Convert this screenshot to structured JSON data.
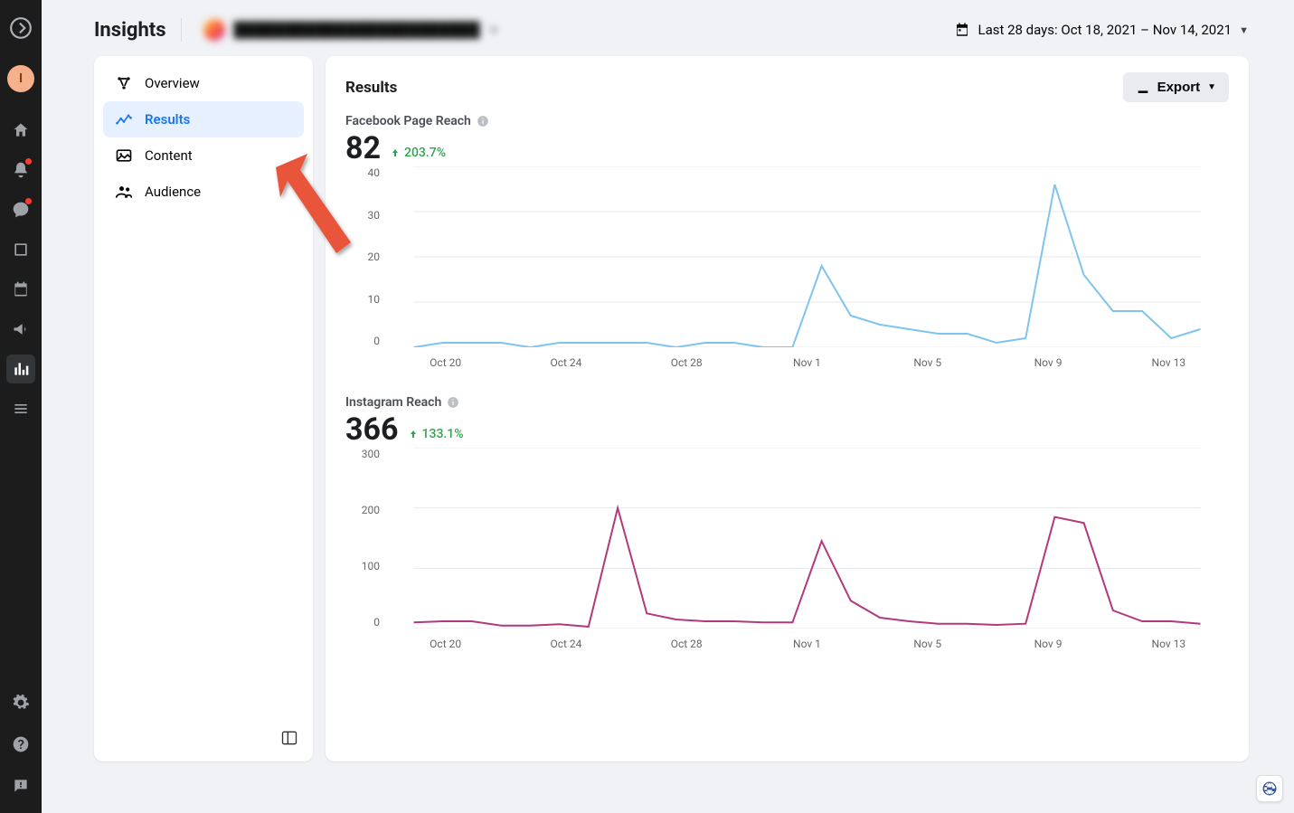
{
  "rail": {
    "avatar_initial": "I"
  },
  "header": {
    "page_title": "Insights",
    "date_label": "Last 28 days: Oct 18, 2021 – Nov 14, 2021"
  },
  "sidebar": {
    "items": [
      {
        "label": "Overview"
      },
      {
        "label": "Results"
      },
      {
        "label": "Content"
      },
      {
        "label": "Audience"
      }
    ]
  },
  "main": {
    "title": "Results",
    "export_label": "Export",
    "metrics": [
      {
        "title": "Facebook Page Reach",
        "value": "82",
        "delta": "203.7%"
      },
      {
        "title": "Instagram Reach",
        "value": "366",
        "delta": "133.1%"
      }
    ]
  },
  "chart_data": [
    {
      "type": "line",
      "title": "Facebook Page Reach",
      "color": "#7fc4ee",
      "ylim": [
        0,
        40
      ],
      "yticks": [
        0,
        10,
        20,
        30,
        40
      ],
      "xticks": [
        "Oct 20",
        "Oct 24",
        "Oct 28",
        "Nov 1",
        "Nov 5",
        "Nov 9",
        "Nov 13"
      ],
      "x": [
        "Oct 18",
        "Oct 19",
        "Oct 20",
        "Oct 21",
        "Oct 22",
        "Oct 23",
        "Oct 24",
        "Oct 25",
        "Oct 26",
        "Oct 27",
        "Oct 28",
        "Oct 29",
        "Oct 30",
        "Oct 31",
        "Nov 1",
        "Nov 2",
        "Nov 3",
        "Nov 4",
        "Nov 5",
        "Nov 6",
        "Nov 7",
        "Nov 8",
        "Nov 9",
        "Nov 10",
        "Nov 11",
        "Nov 12",
        "Nov 13",
        "Nov 14"
      ],
      "values": [
        0,
        1,
        1,
        1,
        0,
        1,
        1,
        1,
        1,
        0,
        1,
        1,
        0,
        0,
        18,
        7,
        5,
        4,
        3,
        3,
        1,
        2,
        36,
        16,
        8,
        8,
        2,
        4
      ]
    },
    {
      "type": "line",
      "title": "Instagram Reach",
      "color": "#b2397e",
      "ylim": [
        0,
        300
      ],
      "yticks": [
        0,
        100,
        200,
        300
      ],
      "xticks": [
        "Oct 20",
        "Oct 24",
        "Oct 28",
        "Nov 1",
        "Nov 5",
        "Nov 9",
        "Nov 13"
      ],
      "x": [
        "Oct 18",
        "Oct 19",
        "Oct 20",
        "Oct 21",
        "Oct 22",
        "Oct 23",
        "Oct 24",
        "Oct 25",
        "Oct 26",
        "Oct 27",
        "Oct 28",
        "Oct 29",
        "Oct 30",
        "Oct 31",
        "Nov 1",
        "Nov 2",
        "Nov 3",
        "Nov 4",
        "Nov 5",
        "Nov 6",
        "Nov 7",
        "Nov 8",
        "Nov 9",
        "Nov 10",
        "Nov 11",
        "Nov 12",
        "Nov 13",
        "Nov 14"
      ],
      "values": [
        10,
        12,
        12,
        5,
        5,
        7,
        3,
        200,
        25,
        15,
        12,
        12,
        10,
        10,
        145,
        46,
        18,
        12,
        8,
        8,
        6,
        8,
        185,
        175,
        30,
        12,
        12,
        8
      ]
    }
  ]
}
